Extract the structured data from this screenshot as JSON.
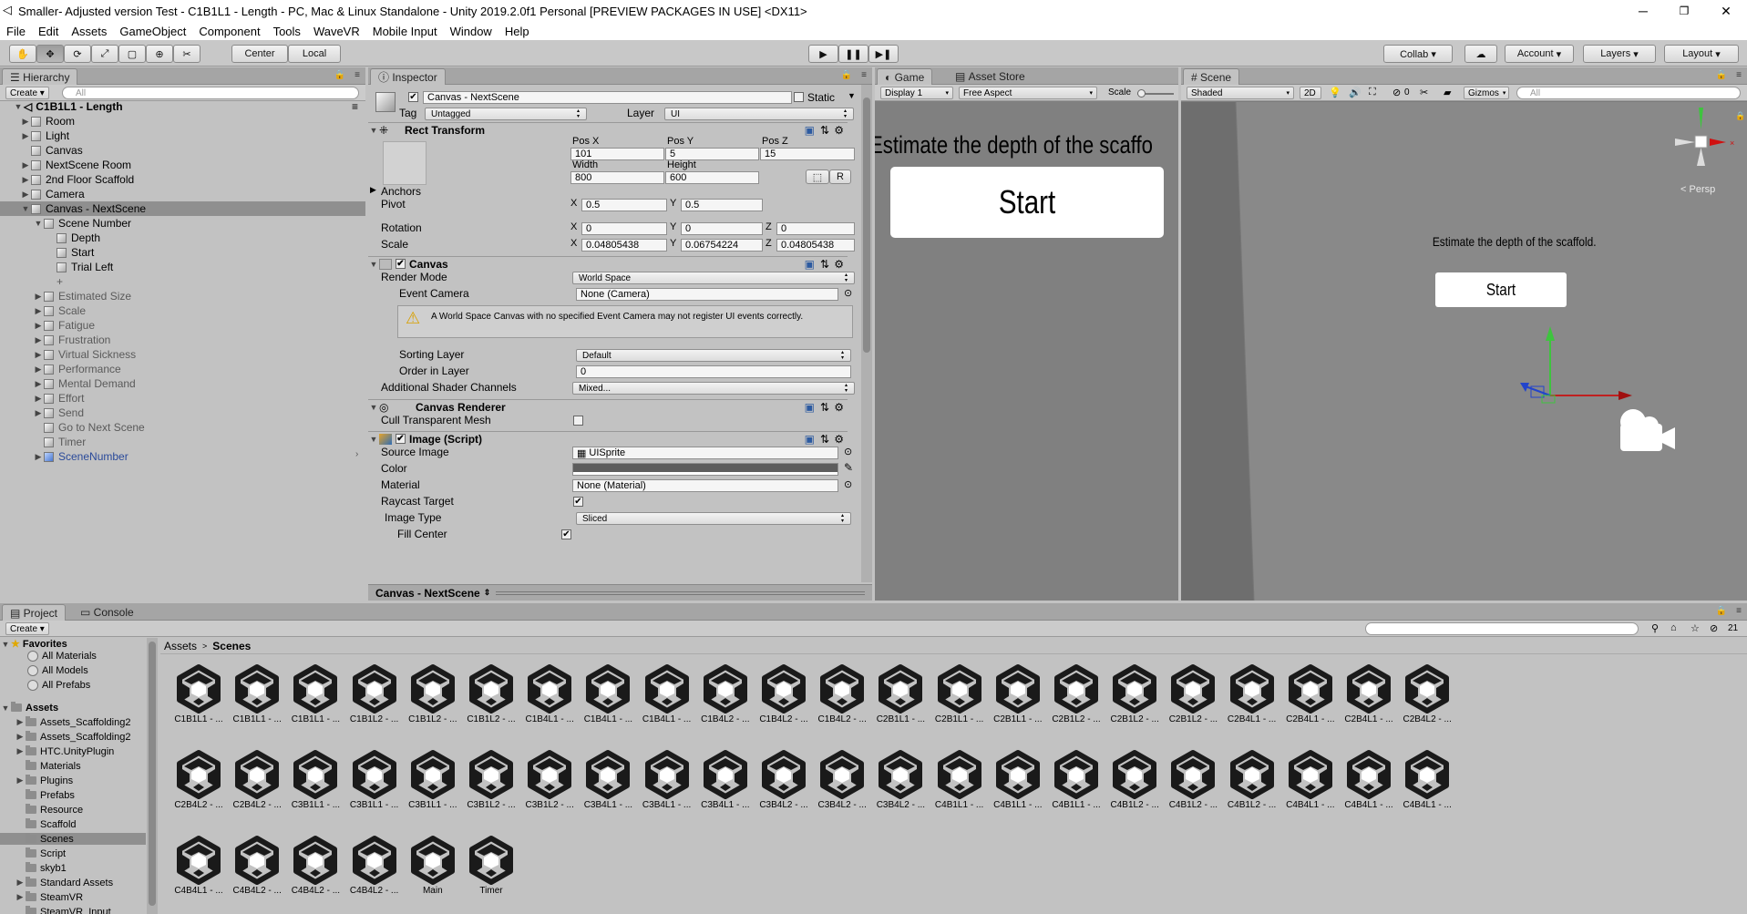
{
  "window": {
    "title": "Smaller- Adjusted version Test - C1B1L1 - Length - PC, Mac & Linux Standalone - Unity 2019.2.0f1 Personal [PREVIEW PACKAGES IN USE] <DX11>",
    "minimize": "─",
    "maximize": "❐",
    "close": "✕"
  },
  "menu": [
    "File",
    "Edit",
    "Assets",
    "GameObject",
    "Component",
    "Tools",
    "WaveVR",
    "Mobile Input",
    "Window",
    "Help"
  ],
  "toolbar": {
    "pivot": "Center",
    "space": "Local",
    "collab": "Collab ▾",
    "account": "Account",
    "layers": "Layers",
    "layout": "Layout"
  },
  "hierarchy": {
    "tab": "Hierarchy",
    "create": "Create ▾",
    "search_placeholder": "All",
    "scene": "C1B1L1 - Length",
    "items": [
      {
        "label": "Room",
        "depth": 1,
        "arrow": "▶",
        "style": ""
      },
      {
        "label": "Light",
        "depth": 1,
        "arrow": "▶",
        "style": ""
      },
      {
        "label": "Canvas",
        "depth": 1,
        "arrow": "",
        "style": ""
      },
      {
        "label": "NextScene Room",
        "depth": 1,
        "arrow": "▶",
        "style": ""
      },
      {
        "label": "2nd Floor Scaffold",
        "depth": 1,
        "arrow": "▶",
        "style": ""
      },
      {
        "label": "Camera",
        "depth": 1,
        "arrow": "▶",
        "style": ""
      },
      {
        "label": "Canvas - NextScene",
        "depth": 1,
        "arrow": "▼",
        "style": "sel"
      },
      {
        "label": "Scene Number",
        "depth": 2,
        "arrow": "▼",
        "style": ""
      },
      {
        "label": "Depth",
        "depth": 3,
        "arrow": "",
        "style": ""
      },
      {
        "label": "Start",
        "depth": 3,
        "arrow": "",
        "style": ""
      },
      {
        "label": "Trial Left",
        "depth": 3,
        "arrow": "",
        "style": ""
      },
      {
        "label": "+",
        "depth": 3,
        "arrow": "",
        "style": "grey"
      },
      {
        "label": "Estimated Size",
        "depth": 2,
        "arrow": "▶",
        "style": "grey"
      },
      {
        "label": "Scale",
        "depth": 2,
        "arrow": "▶",
        "style": "grey"
      },
      {
        "label": "Fatigue",
        "depth": 2,
        "arrow": "▶",
        "style": "grey"
      },
      {
        "label": "Frustration",
        "depth": 2,
        "arrow": "▶",
        "style": "grey"
      },
      {
        "label": "Virtual Sickness",
        "depth": 2,
        "arrow": "▶",
        "style": "grey"
      },
      {
        "label": "Performance",
        "depth": 2,
        "arrow": "▶",
        "style": "grey"
      },
      {
        "label": "Mental Demand",
        "depth": 2,
        "arrow": "▶",
        "style": "grey"
      },
      {
        "label": "Effort",
        "depth": 2,
        "arrow": "▶",
        "style": "grey"
      },
      {
        "label": "Send",
        "depth": 2,
        "arrow": "▶",
        "style": "grey"
      },
      {
        "label": "Go to Next Scene",
        "depth": 2,
        "arrow": "",
        "style": "grey"
      },
      {
        "label": "Timer",
        "depth": 2,
        "arrow": "",
        "style": "grey"
      },
      {
        "label": "SceneNumber",
        "depth": 2,
        "arrow": "▶",
        "style": "blue"
      }
    ]
  },
  "inspector": {
    "tab": "Inspector",
    "object_name": "Canvas - NextScene",
    "static": "Static",
    "tag_label": "Tag",
    "tag": "Untagged",
    "layer_label": "Layer",
    "layer": "UI",
    "rect": {
      "title": "Rect Transform",
      "posx_l": "Pos X",
      "posy_l": "Pos Y",
      "posz_l": "Pos Z",
      "posx": "101",
      "posy": "5",
      "posz": "15",
      "width_l": "Width",
      "height_l": "Height",
      "width": "800",
      "height": "600",
      "r": "R",
      "anchors": "Anchors",
      "pivot": "Pivot",
      "pivot_x": "0.5",
      "pivot_y": "0.5",
      "rotation": "Rotation",
      "rot_x": "0",
      "rot_y": "0",
      "rot_z": "0",
      "scale": "Scale",
      "scale_x": "0.04805438",
      "scale_y": "0.06754224",
      "scale_z": "0.04805438",
      "x": "X",
      "y": "Y",
      "z": "Z"
    },
    "canvas": {
      "title": "Canvas",
      "render_mode_l": "Render Mode",
      "render_mode": "World Space",
      "event_camera_l": "Event Camera",
      "event_camera": "None (Camera)",
      "warning": "A World Space Canvas with no specified Event Camera may not register UI events correctly.",
      "sorting_layer_l": "Sorting Layer",
      "sorting_layer": "Default",
      "order_l": "Order in Layer",
      "order": "0",
      "shader_l": "Additional Shader Channels",
      "shader": "Mixed..."
    },
    "renderer": {
      "title": "Canvas Renderer",
      "cull_l": "Cull Transparent Mesh"
    },
    "image": {
      "title": "Image (Script)",
      "source_l": "Source Image",
      "source": "UISprite",
      "color_l": "Color",
      "material_l": "Material",
      "material": "None (Material)",
      "raycast_l": "Raycast Target",
      "type_l": "Image Type",
      "type": "Sliced",
      "fill_l": "Fill Center"
    },
    "footer": "Canvas - NextScene"
  },
  "game": {
    "tab": "Game",
    "store_tab": "Asset Store",
    "display": "Display 1",
    "aspect": "Free Aspect",
    "scale_l": "Scale",
    "headline": "Estimate the depth of the scaffo",
    "start": "Start"
  },
  "scene": {
    "tab": "Scene",
    "shading": "Shaded",
    "mode2d": "2D",
    "gizmos": "Gizmos",
    "search_placeholder": "All",
    "persp": "Persp",
    "counter": "0",
    "headline": "Estimate the depth of the scaffold.",
    "start": "Start"
  },
  "project": {
    "tab": "Project",
    "console_tab": "Console",
    "create": "Create ▾",
    "count": "21",
    "favorites_l": "Favorites",
    "favorites": [
      "All Materials",
      "All Models",
      "All Prefabs"
    ],
    "assets_l": "Assets",
    "folders": [
      {
        "label": "Assets_Scaffolding2",
        "arrow": "▶"
      },
      {
        "label": "Assets_Scaffolding2",
        "arrow": "▶"
      },
      {
        "label": "HTC.UnityPlugin",
        "arrow": "▶"
      },
      {
        "label": "Materials",
        "arrow": ""
      },
      {
        "label": "Plugins",
        "arrow": "▶"
      },
      {
        "label": "Prefabs",
        "arrow": ""
      },
      {
        "label": "Resource",
        "arrow": ""
      },
      {
        "label": "Scaffold",
        "arrow": ""
      },
      {
        "label": "Scenes",
        "arrow": ""
      },
      {
        "label": "Script",
        "arrow": ""
      },
      {
        "label": "skyb1",
        "arrow": ""
      },
      {
        "label": "Standard Assets",
        "arrow": "▶"
      },
      {
        "label": "SteamVR",
        "arrow": "▶"
      },
      {
        "label": "SteamVR_Input",
        "arrow": ""
      }
    ],
    "breadcrumb": [
      "Assets",
      "Scenes"
    ],
    "scenes": [
      "C1B1L1 - ...",
      "C1B1L1 - ...",
      "C1B1L1 - ...",
      "C1B1L2 - ...",
      "C1B1L2 - ...",
      "C1B1L2 - ...",
      "C1B4L1 - ...",
      "C1B4L1 - ...",
      "C1B4L1 - ...",
      "C1B4L2 - ...",
      "C1B4L2 - ...",
      "C1B4L2 - ...",
      "C2B1L1 - ...",
      "C2B1L1 - ...",
      "C2B1L1 - ...",
      "C2B1L2 - ...",
      "C2B1L2 - ...",
      "C2B1L2 - ...",
      "C2B4L1 - ...",
      "C2B4L1 - ...",
      "C2B4L1 - ...",
      "C2B4L2 - ...",
      "C2B4L2 - ...",
      "C2B4L2 - ...",
      "C3B1L1 - ...",
      "C3B1L1 - ...",
      "C3B1L1 - ...",
      "C3B1L2 - ...",
      "C3B1L2 - ...",
      "C3B4L1 - ...",
      "C3B4L1 - ...",
      "C3B4L1 - ...",
      "C3B4L2 - ...",
      "C3B4L2 - ...",
      "C3B4L2 - ...",
      "C4B1L1 - ...",
      "C4B1L1 - ...",
      "C4B1L1 - ...",
      "C4B1L2 - ...",
      "C4B1L2 - ...",
      "C4B1L2 - ...",
      "C4B4L1 - ...",
      "C4B4L1 - ...",
      "C4B4L1 - ...",
      "C4B4L1 - ...",
      "C4B4L2 - ...",
      "C4B4L2 - ...",
      "C4B4L2 - ...",
      "Main",
      "Timer"
    ]
  }
}
